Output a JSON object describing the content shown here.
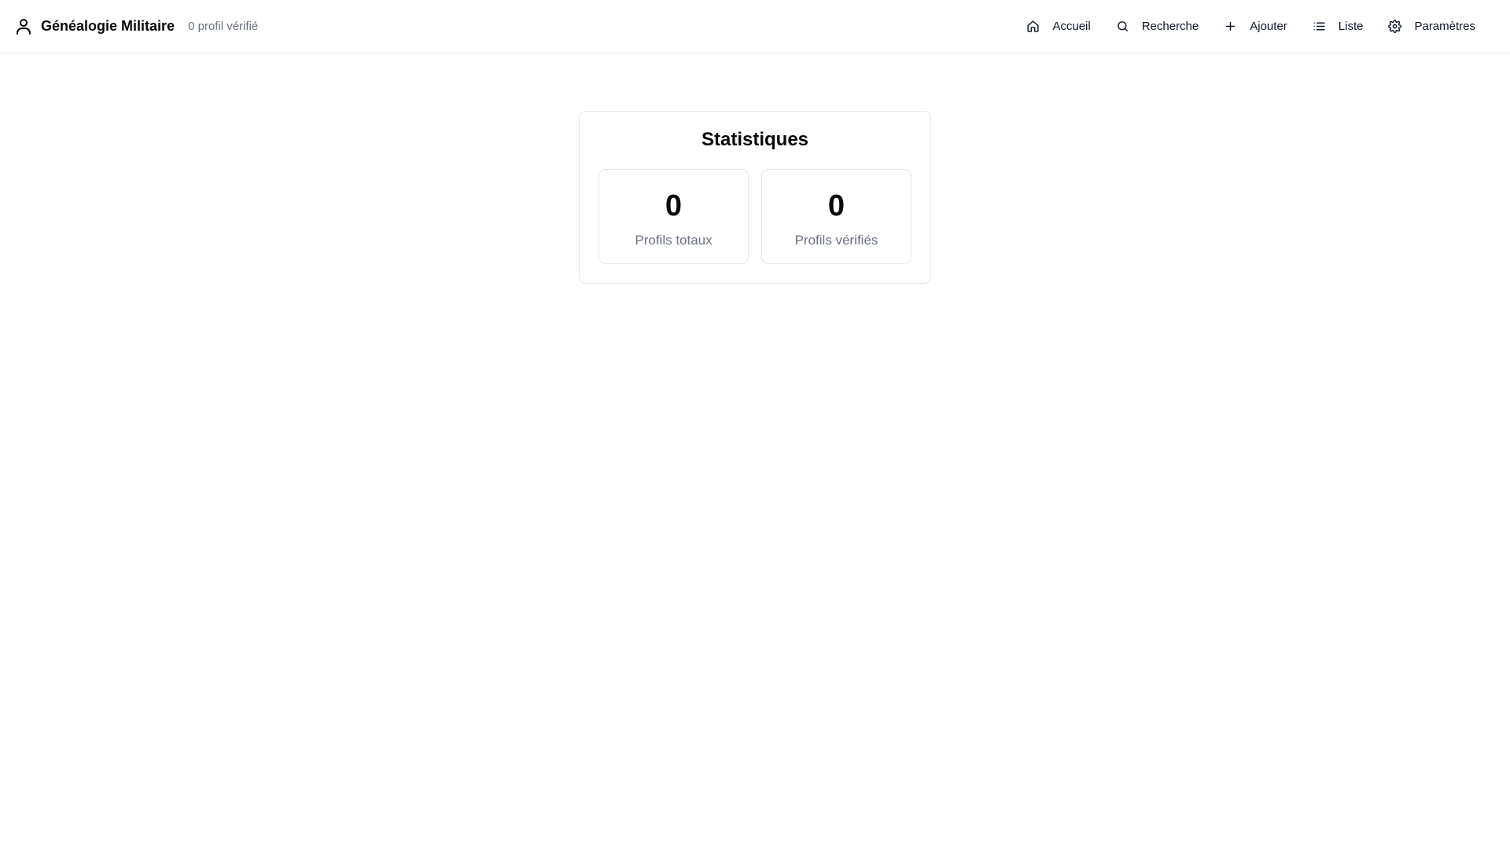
{
  "header": {
    "brand_icon": "user-icon",
    "title": "Généalogie Militaire",
    "subtitle": "0 profil vérifié"
  },
  "nav": {
    "items": [
      {
        "label": "Accueil",
        "icon": "home-icon"
      },
      {
        "label": "Recherche",
        "icon": "search-icon"
      },
      {
        "label": "Ajouter",
        "icon": "plus-icon"
      },
      {
        "label": "Liste",
        "icon": "list-icon"
      },
      {
        "label": "Paramètres",
        "icon": "gear-icon"
      }
    ]
  },
  "stats": {
    "title": "Statistiques",
    "items": [
      {
        "value": "0",
        "label": "Profils totaux"
      },
      {
        "value": "0",
        "label": "Profils vérifiés"
      }
    ]
  },
  "colors": {
    "border": "#e5e7eb",
    "muted_text": "#6b7280",
    "text": "#0a0a0a"
  }
}
